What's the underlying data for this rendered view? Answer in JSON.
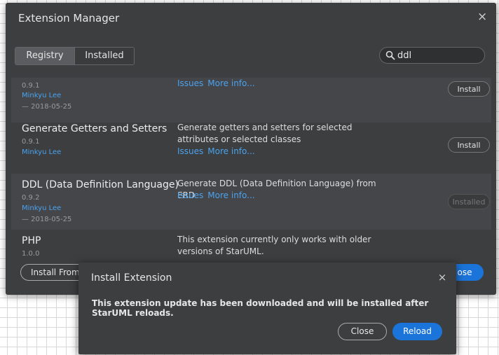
{
  "manager": {
    "title": "Extension Manager",
    "tabs": [
      {
        "label": "Registry",
        "active": true
      },
      {
        "label": "Installed",
        "active": false
      }
    ],
    "search": {
      "value": "ddl",
      "placeholder": ""
    },
    "extensions": [
      {
        "name": "",
        "version": "0.9.1",
        "author": "Minkyu Lee",
        "date": "— 2018-05-25",
        "description": "",
        "links": [
          "Issues",
          "More info..."
        ],
        "action": "Install"
      },
      {
        "name": "Generate Getters and Setters",
        "version": "0.9.1",
        "author": "Minkyu Lee",
        "date": "",
        "description": "Generate getters and setters for selected attributes or selected classes",
        "links": [
          "Issues",
          "More info..."
        ],
        "action": "Install"
      },
      {
        "name": "DDL (Data Definition Language)",
        "version": "0.9.2",
        "author": "Minkyu Lee",
        "date": "— 2018-05-25",
        "description": "Generate DDL (Data Definition Language) from ERD",
        "links": [
          "Issues",
          "More info..."
        ],
        "action": "Installed"
      },
      {
        "name": "PHP",
        "version": "1.0.0",
        "author": "",
        "date": "",
        "description": "This extension currently only works with older versions of StarUML.",
        "links": [],
        "action": ""
      }
    ],
    "footer": {
      "install_from_label": "Install From",
      "close_label": "ose"
    }
  },
  "modal": {
    "title": "Install Extension",
    "message": "This extension update has been downloaded and will be installed after StarUML reloads.",
    "close_label": "Close",
    "reload_label": "Reload"
  },
  "colors": {
    "accent": "#1a74d9",
    "link": "#4aa3ef",
    "panel": "#3d3e40"
  },
  "icons": {
    "close": "close-icon",
    "search": "search-icon"
  }
}
